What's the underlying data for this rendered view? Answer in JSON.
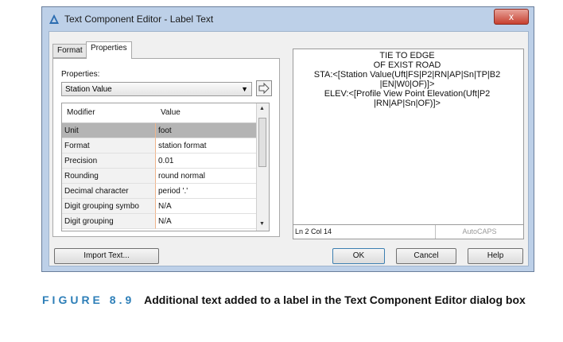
{
  "window": {
    "title": "Text Component Editor - Label Text",
    "close_glyph": "x"
  },
  "tabs": [
    {
      "label": "Format",
      "active": false
    },
    {
      "label": "Properties",
      "active": true
    }
  ],
  "properties": {
    "label": "Properties:",
    "selected": "Station Value"
  },
  "grid": {
    "columns": [
      "Modifier",
      "Value"
    ],
    "rows": [
      {
        "modifier": "Unit",
        "value": "foot",
        "selected": true
      },
      {
        "modifier": "Format",
        "value": "station format"
      },
      {
        "modifier": "Precision",
        "value": "0.01"
      },
      {
        "modifier": "Rounding",
        "value": "round normal"
      },
      {
        "modifier": "Decimal character",
        "value": "period '.'"
      },
      {
        "modifier": "Digit grouping symbo",
        "value": "N/A"
      },
      {
        "modifier": "Digit grouping",
        "value": "N/A"
      }
    ]
  },
  "editor": {
    "lines": [
      "TIE TO EDGE",
      "OF EXIST ROAD",
      "STA:<[Station Value(Uft|FS|P2|RN|AP|Sn|TP|B2",
      "|EN|W0|OF)]>",
      "ELEV:<[Profile View Point Elevation(Uft|P2",
      "|RN|AP|Sn|OF)]>"
    ],
    "status_position": "Ln 2 Col 14",
    "status_mode": "AutoCAPS"
  },
  "buttons": {
    "import": "Import Text...",
    "ok": "OK",
    "cancel": "Cancel",
    "help": "Help"
  },
  "caption": {
    "figure": "FIGURE 8.9",
    "text": "Additional text added to a label in the Text Component Editor dialog box"
  },
  "colors": {
    "accent": "#2e7fb8",
    "window_frame": "#bdd0e8",
    "selected_row": "#b4b4b4"
  }
}
